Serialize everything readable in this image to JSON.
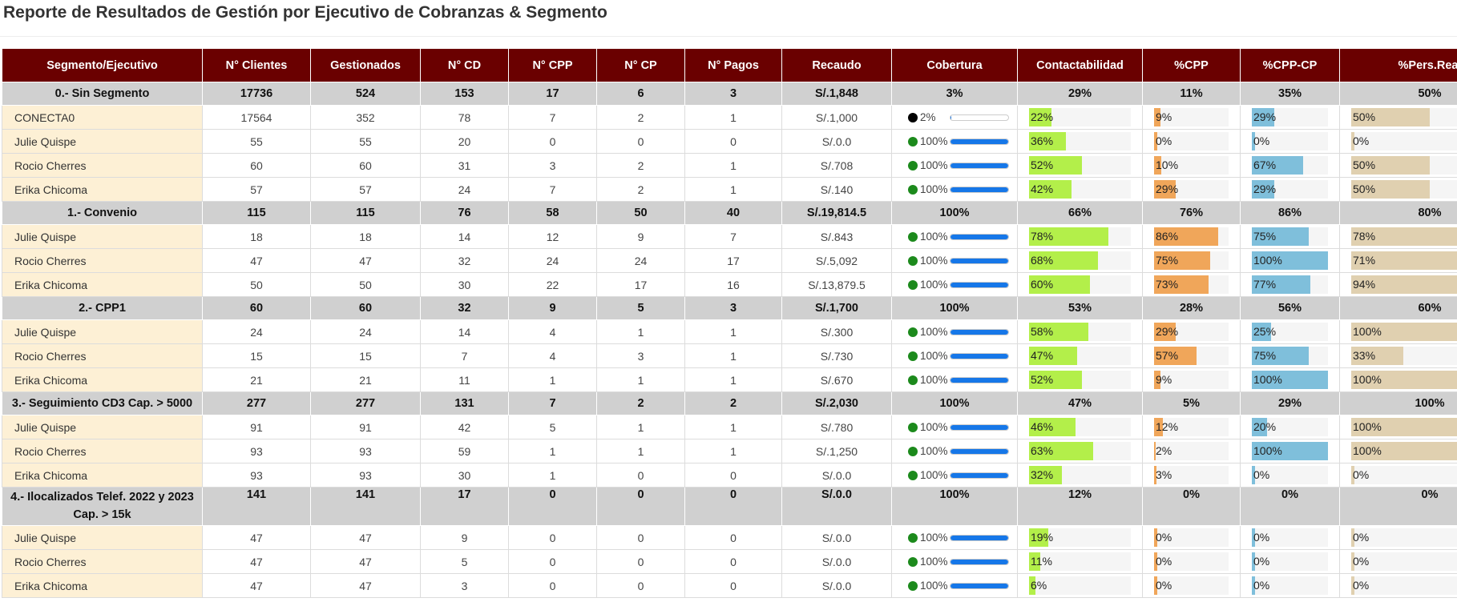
{
  "title": "Reporte de Resultados de Gestión por Ejecutivo de Cobranzas & Segmento",
  "headers": [
    "Segmento/Ejecutivo",
    "N° Clientes",
    "Gestionados",
    "N° CD",
    "N° CPP",
    "N° CP",
    "N° Pagos",
    "Recaudo",
    "Cobertura",
    "Contactabilidad",
    "%CPP",
    "%CPP-CP",
    "%Pers.Real"
  ],
  "colors": {
    "header_bg": "#6a0000",
    "segment_bg": "#d0d0d0",
    "executive_bg": "#fdf0d5",
    "cobertura_bar": "#1677e8",
    "cobertura_dot": "#1c8a1c",
    "contactabilidad_bar": "#b3ef4a",
    "cpp_bar": "#f0a65a",
    "cppcp_bar": "#7fbfdb",
    "persreal_bar": "#e0d0b0"
  },
  "segments": [
    {
      "name": "0.- Sin Segmento",
      "row": [
        "17736",
        "524",
        "153",
        "17",
        "6",
        "3",
        "S/.1,848",
        "3%",
        "29%",
        "11%",
        "35%",
        "50%"
      ],
      "executives": [
        {
          "name": "CONECTA0",
          "cells": [
            "17564",
            "352",
            "78",
            "7",
            "2",
            "1",
            "S/.1,000"
          ],
          "cobertura": "2%",
          "cob_dot": "black",
          "contactabilidad": "22%",
          "cpp": "9%",
          "cppcp": "29%",
          "persreal": "50%"
        },
        {
          "name": "Julie Quispe",
          "cells": [
            "55",
            "55",
            "20",
            "0",
            "0",
            "0",
            "S/.0.0"
          ],
          "cobertura": "100%",
          "contactabilidad": "36%",
          "cpp": "0%",
          "cppcp": "0%",
          "persreal": "0%"
        },
        {
          "name": "Rocio Cherres",
          "cells": [
            "60",
            "60",
            "31",
            "3",
            "2",
            "1",
            "S/.708"
          ],
          "cobertura": "100%",
          "contactabilidad": "52%",
          "cpp": "10%",
          "cppcp": "67%",
          "persreal": "50%"
        },
        {
          "name": "Erika Chicoma",
          "cells": [
            "57",
            "57",
            "24",
            "7",
            "2",
            "1",
            "S/.140"
          ],
          "cobertura": "100%",
          "contactabilidad": "42%",
          "cpp": "29%",
          "cppcp": "29%",
          "persreal": "50%"
        }
      ]
    },
    {
      "name": "1.- Convenio",
      "row": [
        "115",
        "115",
        "76",
        "58",
        "50",
        "40",
        "S/.19,814.5",
        "100%",
        "66%",
        "76%",
        "86%",
        "80%"
      ],
      "executives": [
        {
          "name": "Julie Quispe",
          "cells": [
            "18",
            "18",
            "14",
            "12",
            "9",
            "7",
            "S/.843"
          ],
          "cobertura": "100%",
          "contactabilidad": "78%",
          "cpp": "86%",
          "cppcp": "75%",
          "persreal": "78%"
        },
        {
          "name": "Rocio Cherres",
          "cells": [
            "47",
            "47",
            "32",
            "24",
            "24",
            "17",
            "S/.5,092"
          ],
          "cobertura": "100%",
          "contactabilidad": "68%",
          "cpp": "75%",
          "cppcp": "100%",
          "persreal": "71%"
        },
        {
          "name": "Erika Chicoma",
          "cells": [
            "50",
            "50",
            "30",
            "22",
            "17",
            "16",
            "S/.13,879.5"
          ],
          "cobertura": "100%",
          "contactabilidad": "60%",
          "cpp": "73%",
          "cppcp": "77%",
          "persreal": "94%"
        }
      ]
    },
    {
      "name": "2.- CPP1",
      "row": [
        "60",
        "60",
        "32",
        "9",
        "5",
        "3",
        "S/.1,700",
        "100%",
        "53%",
        "28%",
        "56%",
        "60%"
      ],
      "executives": [
        {
          "name": "Julie Quispe",
          "cells": [
            "24",
            "24",
            "14",
            "4",
            "1",
            "1",
            "S/.300"
          ],
          "cobertura": "100%",
          "contactabilidad": "58%",
          "cpp": "29%",
          "cppcp": "25%",
          "persreal": "100%"
        },
        {
          "name": "Rocio Cherres",
          "cells": [
            "15",
            "15",
            "7",
            "4",
            "3",
            "1",
            "S/.730"
          ],
          "cobertura": "100%",
          "contactabilidad": "47%",
          "cpp": "57%",
          "cppcp": "75%",
          "persreal": "33%"
        },
        {
          "name": "Erika Chicoma",
          "cells": [
            "21",
            "21",
            "11",
            "1",
            "1",
            "1",
            "S/.670"
          ],
          "cobertura": "100%",
          "contactabilidad": "52%",
          "cpp": "9%",
          "cppcp": "100%",
          "persreal": "100%"
        }
      ]
    },
    {
      "name": "3.- Seguimiento CD3 Cap. > 5000",
      "row": [
        "277",
        "277",
        "131",
        "7",
        "2",
        "2",
        "S/.2,030",
        "100%",
        "47%",
        "5%",
        "29%",
        "100%"
      ],
      "executives": [
        {
          "name": "Julie Quispe",
          "cells": [
            "91",
            "91",
            "42",
            "5",
            "1",
            "1",
            "S/.780"
          ],
          "cobertura": "100%",
          "contactabilidad": "46%",
          "cpp": "12%",
          "cppcp": "20%",
          "persreal": "100%"
        },
        {
          "name": "Rocio Cherres",
          "cells": [
            "93",
            "93",
            "59",
            "1",
            "1",
            "1",
            "S/.1,250"
          ],
          "cobertura": "100%",
          "contactabilidad": "63%",
          "cpp": "2%",
          "cppcp": "100%",
          "persreal": "100%"
        },
        {
          "name": "Erika Chicoma",
          "cells": [
            "93",
            "93",
            "30",
            "1",
            "0",
            "0",
            "S/.0.0"
          ],
          "cobertura": "100%",
          "contactabilidad": "32%",
          "cpp": "3%",
          "cppcp": "0%",
          "persreal": "0%"
        }
      ]
    },
    {
      "name": "4.- Ilocalizados Telef. 2022 y 2023 Cap. > 15k",
      "tall": true,
      "row": [
        "141",
        "141",
        "17",
        "0",
        "0",
        "0",
        "S/.0.0",
        "100%",
        "12%",
        "0%",
        "0%",
        "0%"
      ],
      "executives": [
        {
          "name": "Julie Quispe",
          "cells": [
            "47",
            "47",
            "9",
            "0",
            "0",
            "0",
            "S/.0.0"
          ],
          "cobertura": "100%",
          "contactabilidad": "19%",
          "cpp": "0%",
          "cppcp": "0%",
          "persreal": "0%"
        },
        {
          "name": "Rocio Cherres",
          "cells": [
            "47",
            "47",
            "5",
            "0",
            "0",
            "0",
            "S/.0.0"
          ],
          "cobertura": "100%",
          "contactabilidad": "11%",
          "cpp": "0%",
          "cppcp": "0%",
          "persreal": "0%"
        },
        {
          "name": "Erika Chicoma",
          "cells": [
            "47",
            "47",
            "3",
            "0",
            "0",
            "0",
            "S/.0.0"
          ],
          "cobertura": "100%",
          "contactabilidad": "6%",
          "cpp": "0%",
          "cppcp": "0%",
          "persreal": "0%"
        }
      ]
    }
  ]
}
